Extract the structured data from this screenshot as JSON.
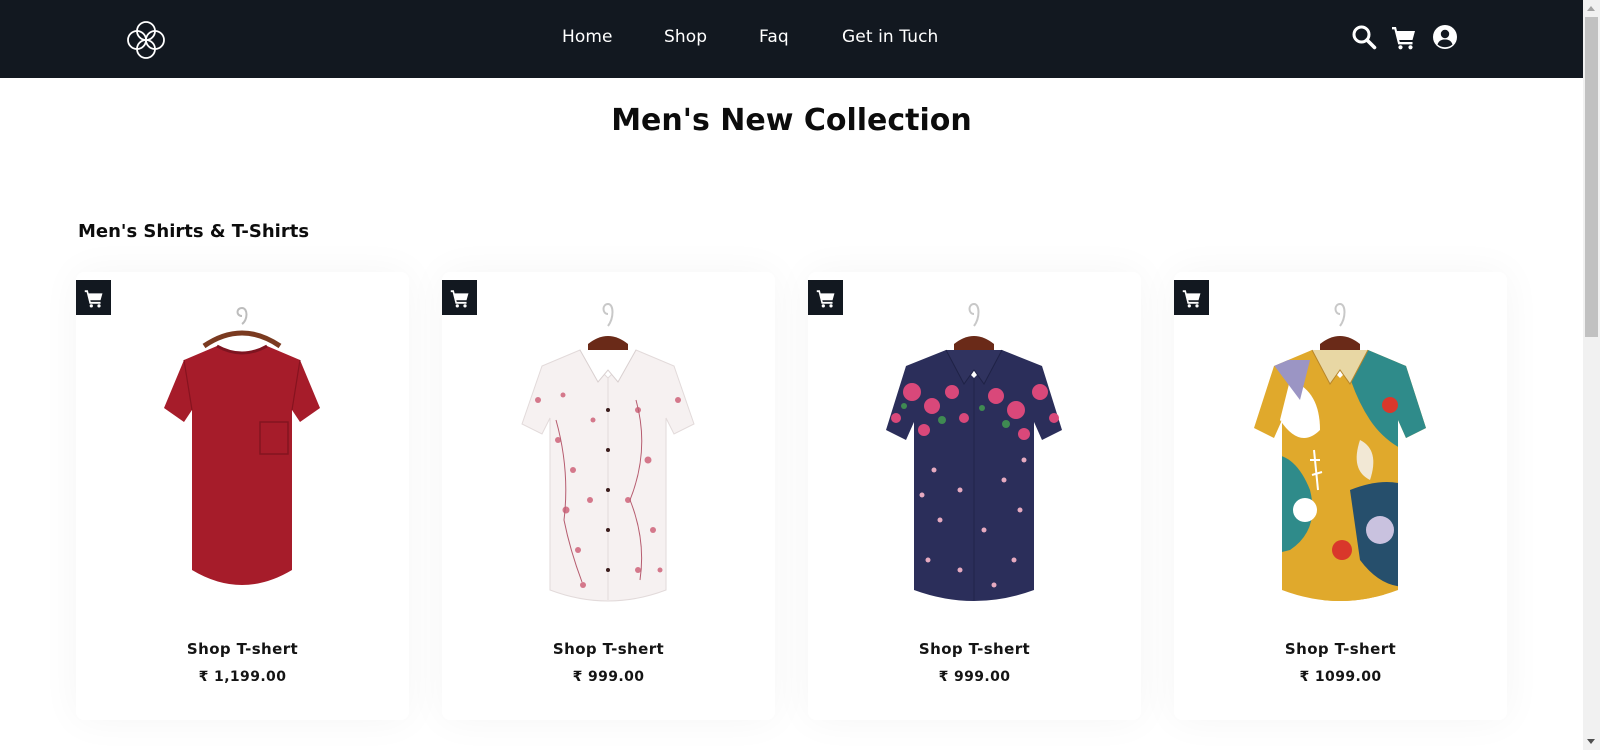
{
  "header": {
    "nav": [
      {
        "label": "Home"
      },
      {
        "label": "Shop"
      },
      {
        "label": "Faq"
      },
      {
        "label": "Get in Tuch"
      }
    ],
    "icons": [
      "logo-icon",
      "search-icon",
      "cart-icon",
      "user-icon"
    ]
  },
  "main": {
    "title": "Men's New Collection",
    "section_title": "Men's Shirts & T-Shirts",
    "products": [
      {
        "name": "Shop T-shert",
        "price": "₹ 1,199.00",
        "image": "red-tshirt",
        "color": "#a61c2a"
      },
      {
        "name": "Shop T-shert",
        "price": "₹ 999.00",
        "image": "white-floral-shirt",
        "color": "#f4eeee"
      },
      {
        "name": "Shop T-shert",
        "price": "₹ 999.00",
        "image": "navy-floral-shirt",
        "color": "#2b2e5a"
      },
      {
        "name": "Shop T-shert",
        "price": "₹ 1099.00",
        "image": "yellow-teal-print-shirt",
        "color": "#e0a92c"
      }
    ]
  },
  "colors": {
    "header_bg": "#121820",
    "cart_button_bg": "#121820",
    "text": "#0f0f0f"
  }
}
